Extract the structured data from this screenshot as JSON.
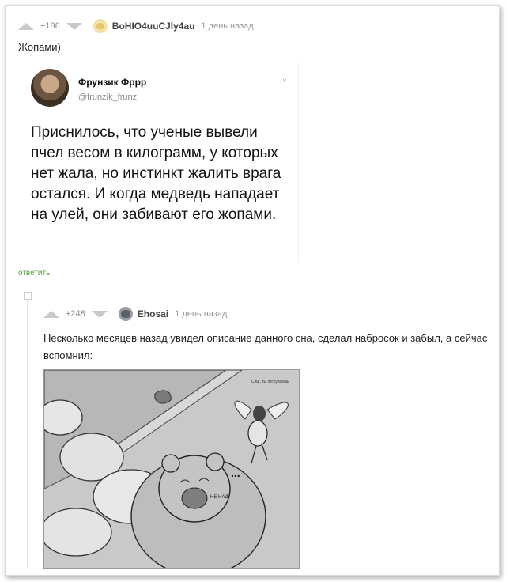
{
  "comment1": {
    "rating": "+186",
    "author": "BoHIO4uuCJly4au",
    "time": "1 день назад",
    "text": "Жопами)",
    "reply_label": "ответить"
  },
  "tweet": {
    "name": "Фрунзик Фррр",
    "handle": "@frunzik_frunz",
    "chevron": "˅",
    "body": "Приснилось, что ученые вывели пчел весом в килограмм, у которых нет жала, но инстинкт жалить врага остался. И когда медведь нападает на улей, они забивают его жопами."
  },
  "comment2": {
    "rating": "+248",
    "author": "Ehosai",
    "time": "1 день назад",
    "text": "Несколько месяцев назад увидел описание данного сна, сделал набросок и забыл, а сейчас вспомнил:",
    "thread_toggle": "−"
  },
  "drawing": {
    "caption_top_right": "Сиш, ты отступаешь",
    "bear_label": "НЕ НАД",
    "dots": "..."
  }
}
